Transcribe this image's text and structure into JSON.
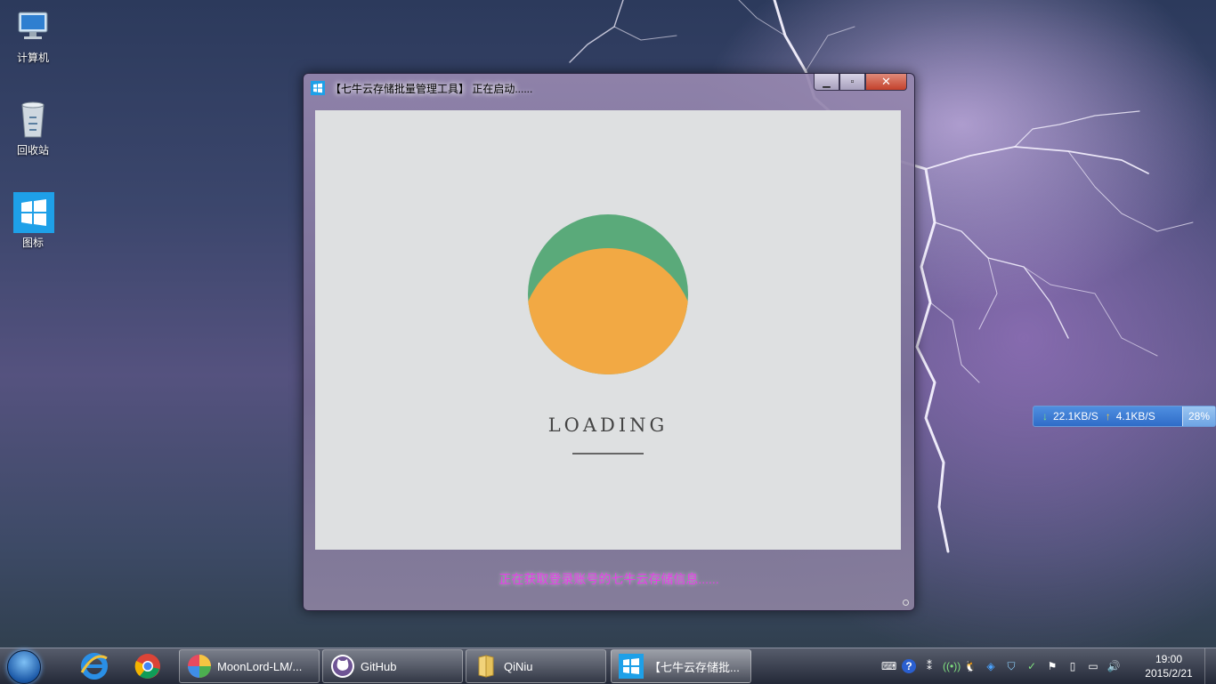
{
  "desktop": {
    "icons": [
      {
        "label": "计算机",
        "icon": "computer-icon"
      },
      {
        "label": "回收站",
        "icon": "recycle-bin-icon"
      },
      {
        "label": "图标",
        "icon": "windows-logo-icon"
      }
    ]
  },
  "window": {
    "title": "【七牛云存储批量管理工具】  正在启动......",
    "buttons": {
      "minimize": "minimize",
      "maximize": "maximize",
      "close": "close"
    },
    "loading_text": "LOADING",
    "status_text": "正在获取登录账号的七牛云存储信息......",
    "colors": {
      "ball_top": "#5aaa7a",
      "ball_bottom": "#f2a944",
      "status": "#e63ce8"
    }
  },
  "network_monitor": {
    "download": "22.1KB/S",
    "upload": "4.1KB/S",
    "percent": "28%"
  },
  "taskbar": {
    "pinned": [
      {
        "name": "internet-explorer-icon"
      },
      {
        "name": "chrome-icon"
      }
    ],
    "tasks": [
      {
        "label": "MoonLord-LM/...",
        "icon": "moonlord-icon"
      },
      {
        "label": "GitHub",
        "icon": "github-icon"
      },
      {
        "label": "QiNiu",
        "icon": "folder-icon"
      },
      {
        "label": "【七牛云存储批...",
        "icon": "windows-logo-icon"
      }
    ],
    "clock": {
      "time": "19:00",
      "date": "2015/2/21"
    }
  }
}
